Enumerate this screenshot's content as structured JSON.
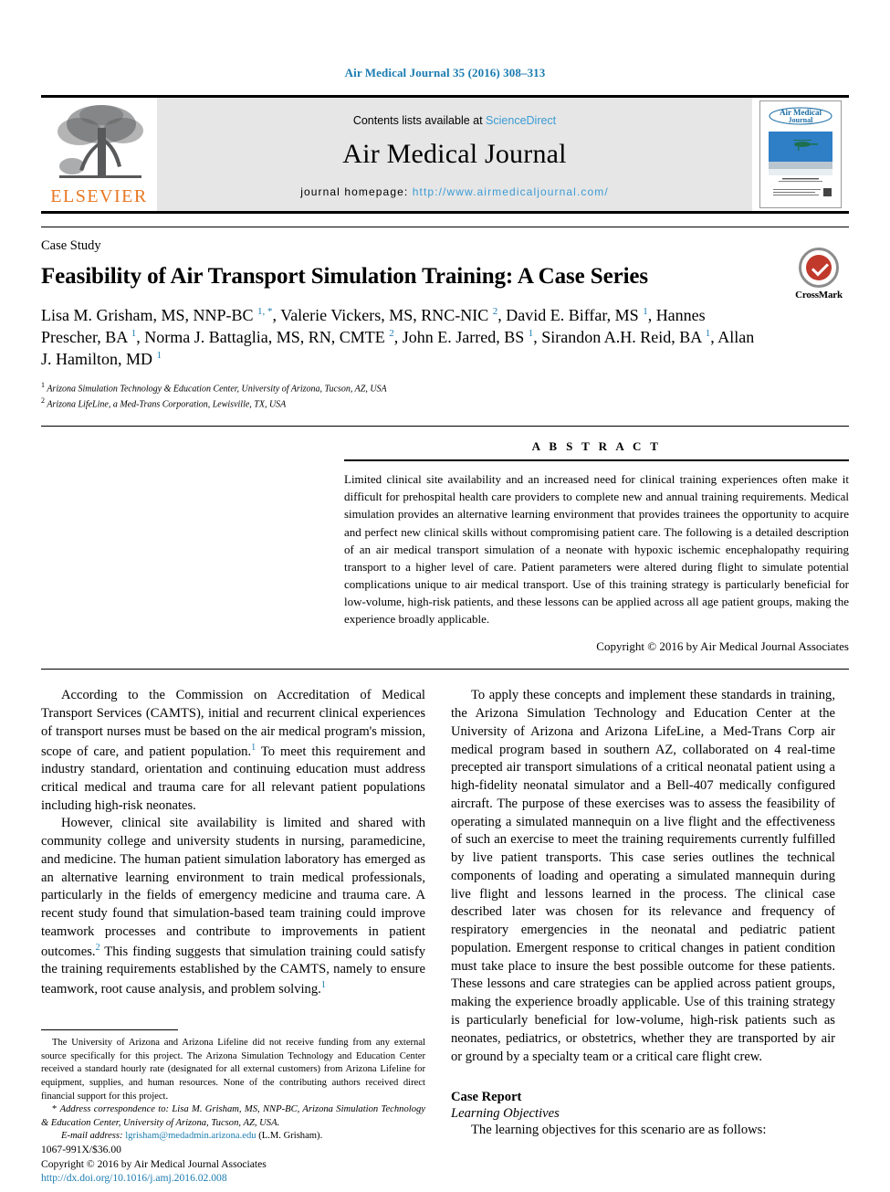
{
  "running_head": "Air Medical Journal 35 (2016) 308–313",
  "masthead": {
    "publisher_name": "ELSEVIER",
    "contents_prefix": "Contents lists available at ",
    "contents_link": "ScienceDirect",
    "journal_name": "Air Medical Journal",
    "homepage_prefix": "journal homepage: ",
    "homepage_url": "http://www.airmedicaljournal.com/",
    "cover_title": "Air Medical Journal"
  },
  "article": {
    "type": "Case Study",
    "title": "Feasibility of Air Transport Simulation Training: A Case Series",
    "authors_line_1": "Lisa M. Grisham, MS, NNP-BC",
    "authors_html": "Lisa M. Grisham, MS, NNP-BC <sup>1, *</sup>, Valerie Vickers, MS, RNC-NIC <sup>2</sup>, David E. Biffar, MS <sup>1</sup>, Hannes Prescher, BA <sup>1</sup>, Norma J. Battaglia, MS, RN, CMTE <sup>2</sup>, John E. Jarred, BS <sup>1</sup>, Sirandon A.H. Reid, BA <sup>1</sup>, Allan J. Hamilton, MD <sup>1</sup>",
    "affiliation_1": "Arizona Simulation Technology & Education Center, University of Arizona, Tucson, AZ, USA",
    "affiliation_2": "Arizona LifeLine, a Med-Trans Corporation, Lewisville, TX, USA",
    "crossmark_label": "CrossMark"
  },
  "abstract": {
    "label": "A B S T R A C T",
    "text": "Limited clinical site availability and an increased need for clinical training experiences often make it difficult for prehospital health care providers to complete new and annual training requirements. Medical simulation provides an alternative learning environment that provides trainees the opportunity to acquire and perfect new clinical skills without compromising patient care. The following is a detailed description of an air medical transport simulation of a neonate with hypoxic ischemic encephalopathy requiring transport to a higher level of care. Patient parameters were altered during flight to simulate potential complications unique to air medical transport. Use of this training strategy is particularly beneficial for low-volume, high-risk patients, and these lessons can be applied across all age patient groups, making the experience broadly applicable.",
    "copyright": "Copyright © 2016 by Air Medical Journal Associates"
  },
  "body": {
    "left_paragraph_1_html": "According to the Commission on Accreditation of Medical Transport Services (CAMTS), initial and recurrent clinical experiences of transport nurses must be based on the air medical program's mission, scope of care, and patient population.<sup>1</sup> To meet this requirement and industry standard, orientation and continuing education must address critical medical and trauma care for all relevant patient populations including high-risk neonates.",
    "left_paragraph_2_html": "However, clinical site availability is limited and shared with community college and university students in nursing, paramedicine, and medicine. The human patient simulation laboratory has emerged as an alternative learning environment to train medical professionals, particularly in the fields of emergency medicine and trauma care. A recent study found that simulation-based team training could improve teamwork processes and contribute to improvements in patient outcomes.<sup>2</sup> This finding suggests that simulation training could satisfy the training requirements established by the CAMTS, namely to ensure teamwork, root cause analysis, and problem solving.<sup>1</sup>",
    "right_paragraph_1_html": "To apply these concepts and implement these standards in training, the Arizona Simulation Technology and Education Center at the University of Arizona and Arizona LifeLine, a Med-Trans Corp air medical program based in southern AZ, collaborated on 4 real-time precepted air transport simulations of a critical neonatal patient using a high-fidelity neonatal simulator and a Bell-407 medically configured aircraft. The purpose of these exercises was to assess the feasibility of operating a simulated mannequin on a live flight and the effectiveness of such an exercise to meet the training requirements currently fulfilled by live patient transports. This case series outlines the technical components of loading and operating a simulated mannequin during live flight and lessons learned in the process. The clinical case described later was chosen for its relevance and frequency of respiratory emergencies in the neonatal and pediatric patient population. Emergent response to critical changes in patient condition must take place to insure the best possible outcome for these patients. These lessons and care strategies can be applied across patient groups, making the experience broadly applicable. Use of this training strategy is particularly beneficial for low-volume, high-risk patients such as neonates, pediatrics, or obstetrics, whether they are transported by air or ground by a specialty team or a critical care flight crew.",
    "case_report_heading": "Case Report",
    "learning_objectives_heading": "Learning Objectives",
    "learning_objectives_intro": "The learning objectives for this scenario are as follows:"
  },
  "footnotes": {
    "funding_html": "The University of Arizona and Arizona Lifeline did not receive funding from any external source specifically for this project. The Arizona Simulation Technology and Education Center received a standard hourly rate (designated for all external customers) from Arizona Lifeline for equipment, supplies, and human resources. None of the contributing authors received direct financial support for this project.",
    "correspondence_html": "* <i>Address correspondence to: Lisa M. Grisham, MS, NNP-BC, Arizona Simulation Technology &amp; Education Center, University of Arizona, Tucson, AZ, USA.</i>",
    "email_prefix": "E-mail address:",
    "email": "lgrisham@medadmin.arizona.edu",
    "email_suffix": "(L.M. Grisham)."
  },
  "publisher": {
    "issn_line": "1067-991X/$36.00",
    "copyright_line": "Copyright © 2016 by Air Medical Journal Associates",
    "doi": "http://dx.doi.org/10.1016/j.amj.2016.02.008"
  },
  "colors": {
    "link_blue": "#1a7bb0",
    "sciencedirect_blue": "#3c9bd4",
    "elsevier_orange": "#E87722",
    "band_gray": "#e6e6e6",
    "crossmark_red": "#c0392b"
  }
}
